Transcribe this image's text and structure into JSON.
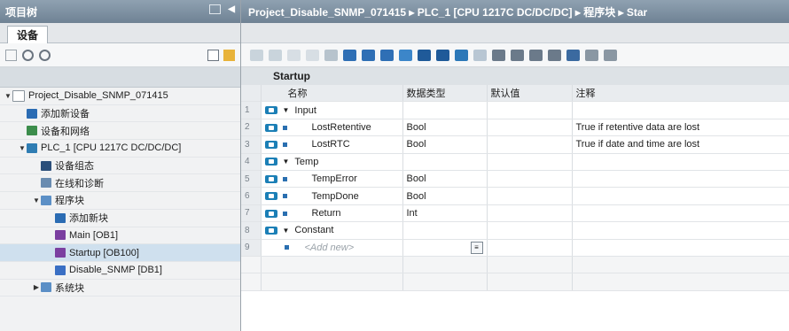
{
  "left_panel": {
    "title": "项目树",
    "tab": "设备",
    "tree": [
      {
        "label": "Project_Disable_SNMP_071415",
        "indent": 0,
        "caret": "▼",
        "icon": "project-icon",
        "color": "#ffffff"
      },
      {
        "label": "添加新设备",
        "indent": 1,
        "caret": "",
        "icon": "add-device-icon",
        "color": "#2b6cb3"
      },
      {
        "label": "设备和网络",
        "indent": 1,
        "caret": "",
        "icon": "network-icon",
        "color": "#3c8d4c"
      },
      {
        "label": "PLC_1 [CPU 1217C DC/DC/DC]",
        "indent": 1,
        "caret": "▼",
        "icon": "plc-icon",
        "color": "#2f7db3"
      },
      {
        "label": "设备组态",
        "indent": 2,
        "caret": "",
        "icon": "device-config-icon",
        "color": "#2b4f7a"
      },
      {
        "label": "在线和诊断",
        "indent": 2,
        "caret": "",
        "icon": "diagnostics-icon",
        "color": "#6a8cb0"
      },
      {
        "label": "程序块",
        "indent": 2,
        "caret": "▼",
        "icon": "folder-icon",
        "color": "#5b8fc6"
      },
      {
        "label": "添加新块",
        "indent": 3,
        "caret": "",
        "icon": "add-block-icon",
        "color": "#2b6cb3"
      },
      {
        "label": "Main [OB1]",
        "indent": 3,
        "caret": "",
        "icon": "ob-icon",
        "color": "#7b3fa0"
      },
      {
        "label": "Startup [OB100]",
        "indent": 3,
        "caret": "",
        "icon": "ob-icon",
        "color": "#7b3fa0",
        "selected": true
      },
      {
        "label": "Disable_SNMP [DB1]",
        "indent": 3,
        "caret": "",
        "icon": "db-icon",
        "color": "#3a6fc4"
      },
      {
        "label": "系统块",
        "indent": 2,
        "caret": "▶",
        "icon": "folder-icon",
        "color": "#5b8fc6"
      }
    ]
  },
  "editor": {
    "breadcrumb": "Project_Disable_SNMP_071415 ▸ PLC_1 [CPU 1217C DC/DC/DC] ▸ 程序块 ▸ Star",
    "block_name": "Startup",
    "columns": [
      "名称",
      "数据类型",
      "默认值",
      "注释"
    ],
    "rows": [
      {
        "num": "1",
        "name": "Input",
        "type": "",
        "default": "",
        "comment": "",
        "level": 0,
        "expand": true
      },
      {
        "num": "2",
        "name": "LostRetentive",
        "type": "Bool",
        "default": "",
        "comment": "True if retentive data are lost",
        "level": 1
      },
      {
        "num": "3",
        "name": "LostRTC",
        "type": "Bool",
        "default": "",
        "comment": "True if date and time are lost",
        "level": 1
      },
      {
        "num": "4",
        "name": "Temp",
        "type": "",
        "default": "",
        "comment": "",
        "level": 0,
        "expand": true
      },
      {
        "num": "5",
        "name": "TempError",
        "type": "Bool",
        "default": "",
        "comment": "",
        "level": 1
      },
      {
        "num": "6",
        "name": "TempDone",
        "type": "Bool",
        "default": "",
        "comment": "",
        "level": 1
      },
      {
        "num": "7",
        "name": "Return",
        "type": "Int",
        "default": "",
        "comment": "",
        "level": 1
      },
      {
        "num": "8",
        "name": "Constant",
        "type": "",
        "default": "",
        "comment": "",
        "level": 0,
        "expand": true
      },
      {
        "num": "9",
        "name": "<Add new>",
        "type": "",
        "default": "",
        "comment": "",
        "level": 1,
        "addnew": true
      }
    ]
  },
  "colors": {
    "title_bar": "#7b8fa2",
    "selection": "#cfe0ee",
    "pin": "#1b7fb6"
  }
}
